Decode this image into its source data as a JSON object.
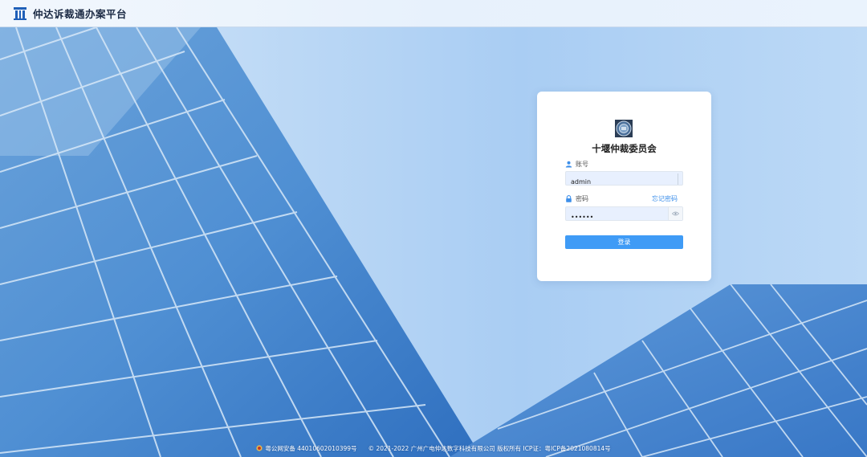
{
  "header": {
    "app_title": "仲达诉裁通办案平台",
    "logo_icon": "pillar-logo-icon"
  },
  "login": {
    "org_name": "十堰仲裁委员会",
    "emblem_icon": "arbitration-emblem-icon",
    "account_label": "账号",
    "account_icon": "user-icon",
    "account_value": "admin",
    "password_label": "密码",
    "password_icon": "lock-icon",
    "password_value": "••••••",
    "forgot_password_link": "忘记密码",
    "eye_icon": "eye-icon",
    "submit_label": "登录"
  },
  "footer": {
    "police_record": "粤公网安备 44010602010399号",
    "copyright": "© 2021-2022 广州广电仲达数字科技有限公司 版权所有 ICP证：粤ICP备2021080814号",
    "police_icon": "police-badge-icon"
  },
  "colors": {
    "primary": "#3f9bf6",
    "link": "#3d8fea",
    "input_bg": "#e8f0fe"
  }
}
